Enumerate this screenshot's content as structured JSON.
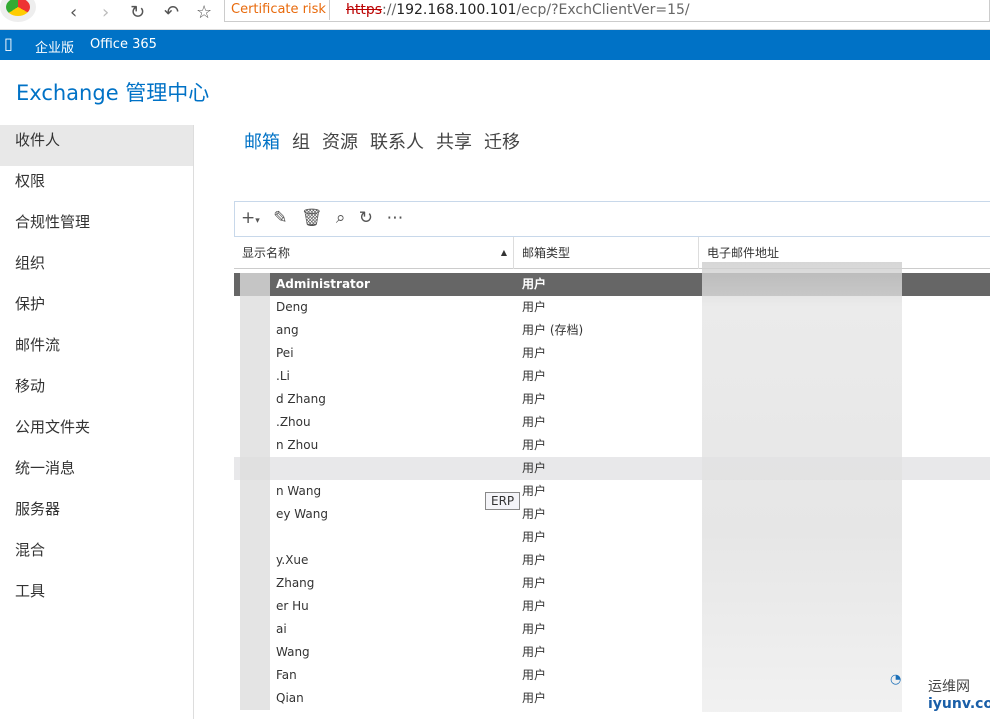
{
  "browser": {
    "cert": "Certificate risk",
    "url_scheme": "https",
    "url_host": "192.168.100.101",
    "url_path": "/ecp/?ExchClientVer=15/"
  },
  "o365": {
    "edition": "企业版",
    "office": "Office 365"
  },
  "title": "Exchange 管理中心",
  "sidebar": [
    "收件人",
    "权限",
    "合规性管理",
    "组织",
    "保护",
    "邮件流",
    "移动",
    "公用文件夹",
    "统一消息",
    "服务器",
    "混合",
    "工具"
  ],
  "tabs": [
    "邮箱",
    "组",
    "资源",
    "联系人",
    "共享",
    "迁移"
  ],
  "columns": [
    "显示名称",
    "邮箱类型",
    "电子邮件地址"
  ],
  "rows": [
    {
      "name": "Administrator",
      "type": "用户"
    },
    {
      "name": "Deng",
      "type": "用户"
    },
    {
      "name": "ang",
      "type": "用户 (存档)"
    },
    {
      "name": "Pei",
      "type": "用户"
    },
    {
      "name": ".Li",
      "type": "用户"
    },
    {
      "name": "d Zhang",
      "type": "用户"
    },
    {
      "name": ".Zhou",
      "type": "用户"
    },
    {
      "name": "n Zhou",
      "type": "用户"
    },
    {
      "name": "",
      "type": "用户"
    },
    {
      "name": "n Wang",
      "type": "用户"
    },
    {
      "name": "ey Wang",
      "type": "用户"
    },
    {
      "name": "",
      "type": "用户"
    },
    {
      "name": "y.Xue",
      "type": "用户"
    },
    {
      "name": "Zhang",
      "type": "用户"
    },
    {
      "name": "er Hu",
      "type": "用户"
    },
    {
      "name": "ai",
      "type": "用户"
    },
    {
      "name": "Wang",
      "type": "用户"
    },
    {
      "name": "Fan",
      "type": "用户"
    },
    {
      "name": "Qian",
      "type": "用户"
    }
  ],
  "tooltip": "ERP",
  "watermark": {
    "cn": "运维网",
    "site": "iyunv.com"
  }
}
